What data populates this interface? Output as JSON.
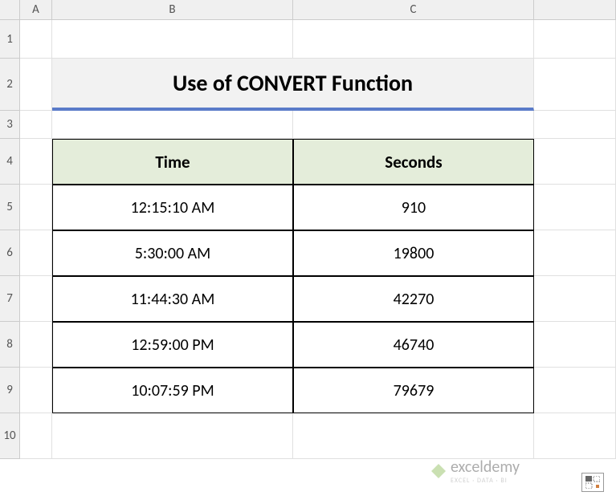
{
  "columns": [
    "A",
    "B",
    "C"
  ],
  "rows": [
    "1",
    "2",
    "3",
    "4",
    "5",
    "6",
    "7",
    "8",
    "9",
    "10"
  ],
  "title": "Use of CONVERT Function",
  "headers": {
    "time": "Time",
    "seconds": "Seconds"
  },
  "chart_data": {
    "type": "table",
    "title": "Use of CONVERT Function",
    "columns": [
      "Time",
      "Seconds"
    ],
    "rows": [
      {
        "time": "12:15:10 AM",
        "seconds": 910
      },
      {
        "time": "5:30:00 AM",
        "seconds": 19800
      },
      {
        "time": "11:44:30 AM",
        "seconds": 42270
      },
      {
        "time": "12:59:00 PM",
        "seconds": 46740
      },
      {
        "time": "10:07:59 PM",
        "seconds": 79679
      }
    ]
  },
  "watermark": {
    "brand": "exceldemy",
    "tagline": "EXCEL · DATA · BI"
  }
}
